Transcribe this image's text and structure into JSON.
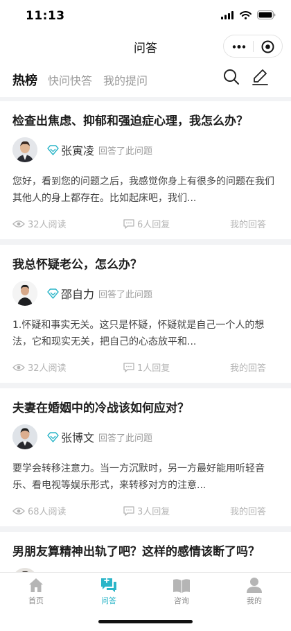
{
  "status_bar": {
    "time": "11:13"
  },
  "nav": {
    "title": "问答"
  },
  "tabs": [
    {
      "label": "热榜",
      "active": true
    },
    {
      "label": "快问快答",
      "active": false
    },
    {
      "label": "我的提问",
      "active": false
    }
  ],
  "questions": [
    {
      "title": "检查出焦虑、抑郁和强迫症心理，我怎么办？",
      "author": "张寅凌",
      "action": "回答了此问题",
      "excerpt": "您好，看到您的问题之后，我感觉你身上有很多的问题在我们其他人的身上都存在。比如起床吧，我们...",
      "views": "32人阅读",
      "replies": "6人回复",
      "mine": "我的回答"
    },
    {
      "title": "我总怀疑老公，怎么办？",
      "author": "邵自力",
      "action": "回答了此问题",
      "excerpt": "1.怀疑和事实无关。这只是怀疑，怀疑就是自己一个人的想法，它和现实无关，把自己的心态放平和...",
      "views": "32人阅读",
      "replies": "1人回复",
      "mine": "我的回答"
    },
    {
      "title": "夫妻在婚姻中的冷战该如何应对？",
      "author": "张博文",
      "action": "回答了此问题",
      "excerpt": "要学会转移注意力。当一方沉默时，另一方最好能用听轻音乐、看电视等娱乐形式，来转移对方的注意...",
      "views": "68人阅读",
      "replies": "3人回复",
      "mine": "我的回答"
    },
    {
      "title": "男朋友算精神出轨了吧？这样的感情该断了吗？"
    }
  ],
  "tabbar": [
    {
      "label": "首页",
      "icon": "home-icon",
      "active": false
    },
    {
      "label": "问答",
      "icon": "qa-chat-icon",
      "active": true
    },
    {
      "label": "咨询",
      "icon": "book-icon",
      "active": false
    },
    {
      "label": "我的",
      "icon": "user-icon",
      "active": false
    }
  ],
  "colors": {
    "accent": "#2bb5c8",
    "muted": "#b3b3b3",
    "background": "#f2f3f5"
  }
}
